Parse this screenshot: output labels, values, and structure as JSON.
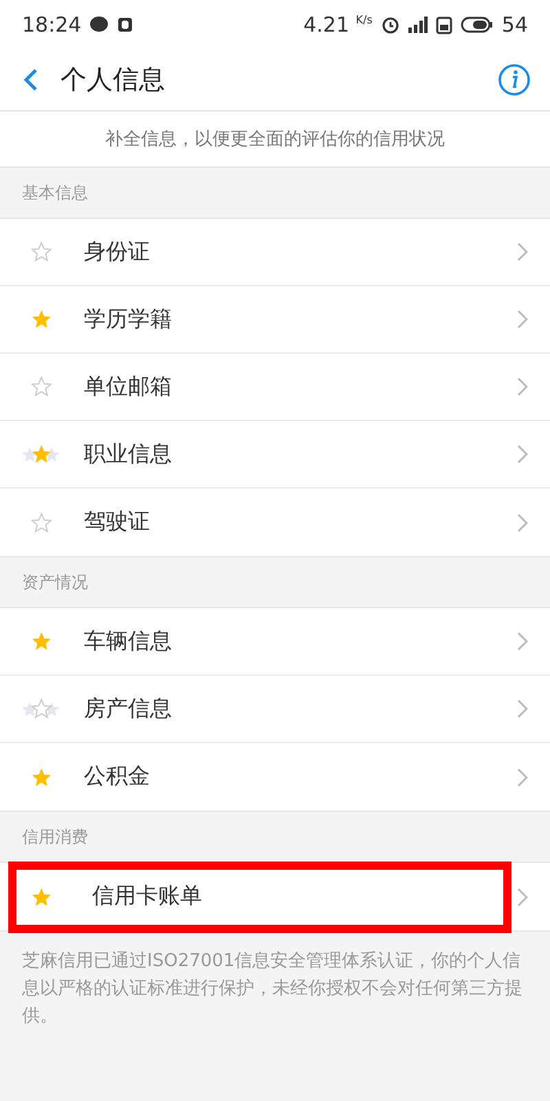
{
  "status_bar": {
    "time": "18:24",
    "speed": "4.21",
    "speed_unit": "K/s",
    "battery": "54"
  },
  "header": {
    "title": "个人信息"
  },
  "notice": "补全信息，以便更全面的评估你的信用状况",
  "sections": [
    {
      "title": "基本信息",
      "items": [
        {
          "label": "身份证",
          "kind": "single",
          "filled": false,
          "highlighted": false
        },
        {
          "label": "学历学籍",
          "kind": "single",
          "filled": true,
          "highlighted": false
        },
        {
          "label": "单位邮箱",
          "kind": "single",
          "filled": false,
          "highlighted": false
        },
        {
          "label": "职业信息",
          "kind": "triple",
          "filled": true,
          "highlighted": false
        },
        {
          "label": "驾驶证",
          "kind": "single",
          "filled": false,
          "highlighted": false
        }
      ]
    },
    {
      "title": "资产情况",
      "items": [
        {
          "label": "车辆信息",
          "kind": "single",
          "filled": true,
          "highlighted": false
        },
        {
          "label": "房产信息",
          "kind": "triple",
          "filled": false,
          "highlighted": false
        },
        {
          "label": "公积金",
          "kind": "single",
          "filled": true,
          "highlighted": false
        }
      ]
    },
    {
      "title": "信用消费",
      "items": [
        {
          "label": "信用卡账单",
          "kind": "single",
          "filled": true,
          "highlighted": true
        }
      ]
    }
  ],
  "footer": "芝麻信用已通过ISO27001信息安全管理体系认证，你的个人信息以严格的认证标准进行保护，未经你授权不会对任何第三方提供。"
}
